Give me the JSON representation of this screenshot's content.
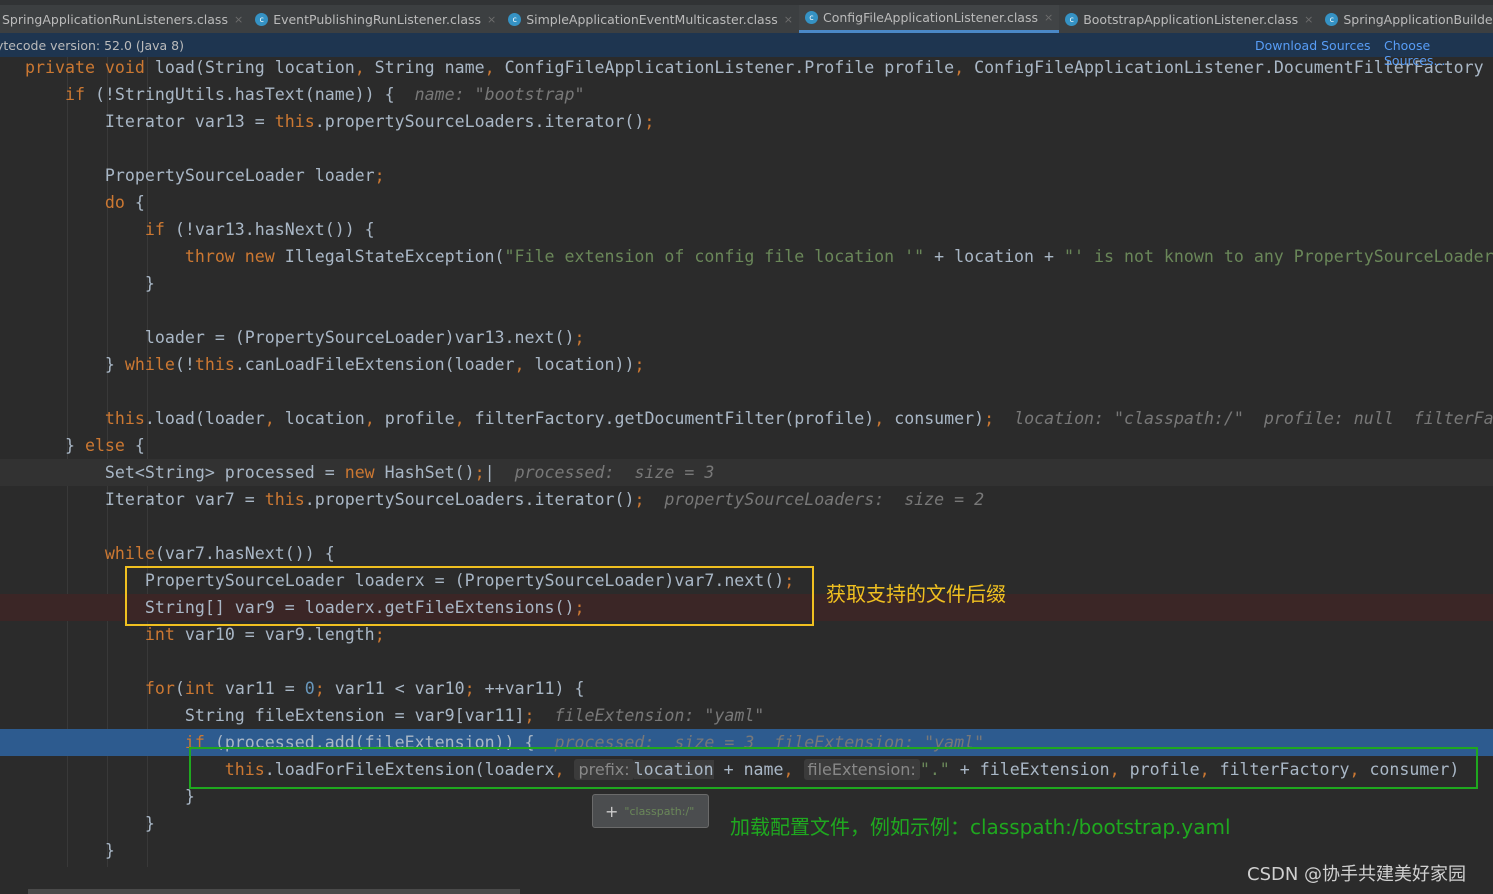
{
  "tabs": [
    {
      "label": "SpringApplicationRunListeners.class",
      "active": false
    },
    {
      "label": "EventPublishingRunListener.class",
      "active": false
    },
    {
      "label": "SimpleApplicationEventMulticaster.class",
      "active": false
    },
    {
      "label": "ConfigFileApplicationListener.class",
      "active": true
    },
    {
      "label": "BootstrapApplicationListener.class",
      "active": false
    },
    {
      "label": "SpringApplicationBuilder.class",
      "active": false
    }
  ],
  "info_bar": {
    "version": "ytecode version: 52.0 (Java 8)",
    "download": "Download Sources",
    "choose": "Choose Sources..."
  },
  "code_lines": [
    {
      "bg": "",
      "tokens": [
        [
          "k",
          "private void "
        ],
        [
          "t",
          "load(String location"
        ],
        [
          "k",
          ", "
        ],
        [
          "t",
          "String name"
        ],
        [
          "k",
          ", "
        ],
        [
          "t",
          "ConfigFileApplicationListener.Profile profile"
        ],
        [
          "k",
          ", "
        ],
        [
          "t",
          "ConfigFileApplicationListener.DocumentFilterFactory"
        ]
      ]
    },
    {
      "bg": "",
      "tokens": [
        [
          "k",
          "    if "
        ],
        [
          "t",
          "(!StringUtils.hasText(name)) {  "
        ],
        [
          "h",
          "name: \"bootstrap\""
        ]
      ]
    },
    {
      "bg": "",
      "tokens": [
        [
          "t",
          "        Iterator var13 = "
        ],
        [
          "k",
          "this"
        ],
        [
          "t",
          ".propertySourceLoaders.iterator()"
        ],
        [
          "k",
          ";"
        ]
      ]
    },
    {
      "bg": "",
      "tokens": []
    },
    {
      "bg": "",
      "tokens": [
        [
          "t",
          "        PropertySourceLoader loader"
        ],
        [
          "k",
          ";"
        ]
      ]
    },
    {
      "bg": "",
      "tokens": [
        [
          "k",
          "        do "
        ],
        [
          "t",
          "{"
        ]
      ]
    },
    {
      "bg": "",
      "tokens": [
        [
          "k",
          "            if "
        ],
        [
          "t",
          "(!var13.hasNext()) {"
        ]
      ]
    },
    {
      "bg": "",
      "tokens": [
        [
          "k",
          "                throw new "
        ],
        [
          "t",
          "IllegalStateException("
        ],
        [
          "s",
          "\"File extension of config file location '\""
        ],
        [
          "t",
          " + location + "
        ],
        [
          "s",
          "\"' is not known to any PropertySourceLoader"
        ]
      ]
    },
    {
      "bg": "",
      "tokens": [
        [
          "t",
          "            }"
        ]
      ]
    },
    {
      "bg": "",
      "tokens": []
    },
    {
      "bg": "",
      "tokens": [
        [
          "t",
          "            loader = (PropertySourceLoader)var13.next()"
        ],
        [
          "k",
          ";"
        ]
      ]
    },
    {
      "bg": "",
      "tokens": [
        [
          "t",
          "        } "
        ],
        [
          "k",
          "while"
        ],
        [
          "t",
          "(!"
        ],
        [
          "k",
          "this"
        ],
        [
          "t",
          ".canLoadFileExtension(loader"
        ],
        [
          "k",
          ", "
        ],
        [
          "t",
          "location))"
        ],
        [
          "k",
          ";"
        ]
      ]
    },
    {
      "bg": "",
      "tokens": []
    },
    {
      "bg": "",
      "tokens": [
        [
          "k",
          "        this"
        ],
        [
          "t",
          ".load(loader"
        ],
        [
          "k",
          ", "
        ],
        [
          "t",
          "location"
        ],
        [
          "k",
          ", "
        ],
        [
          "t",
          "profile"
        ],
        [
          "k",
          ", "
        ],
        [
          "t",
          "filterFactory.getDocumentFilter(profile)"
        ],
        [
          "k",
          ", "
        ],
        [
          "t",
          "consumer)"
        ],
        [
          "k",
          ";  "
        ],
        [
          "h",
          "location: \"classpath:/\"  profile: null  filterFa"
        ]
      ]
    },
    {
      "bg": "",
      "tokens": [
        [
          "t",
          "    } "
        ],
        [
          "k",
          "else "
        ],
        [
          "t",
          "{"
        ]
      ]
    },
    {
      "bg": "cur",
      "tokens": [
        [
          "t",
          "        Set<String> processed = "
        ],
        [
          "k",
          "new "
        ],
        [
          "t",
          "HashSet()"
        ],
        [
          "k",
          ";"
        ],
        [
          "t",
          "|  "
        ],
        [
          "h",
          "processed:  size = 3"
        ]
      ]
    },
    {
      "bg": "",
      "tokens": [
        [
          "t",
          "        Iterator var7 = "
        ],
        [
          "k",
          "this"
        ],
        [
          "t",
          ".propertySourceLoaders.iterator()"
        ],
        [
          "k",
          ";  "
        ],
        [
          "h",
          "propertySourceLoaders:  size = 2"
        ]
      ]
    },
    {
      "bg": "",
      "tokens": []
    },
    {
      "bg": "",
      "tokens": [
        [
          "k",
          "        while"
        ],
        [
          "t",
          "(var7.hasNext()) {"
        ]
      ]
    },
    {
      "bg": "",
      "tokens": [
        [
          "t",
          "            PropertySourceLoader loaderx = (PropertySourceLoader)var7.next()"
        ],
        [
          "k",
          ";"
        ]
      ]
    },
    {
      "bg": "bp",
      "tokens": [
        [
          "t",
          "            String[] var9 = loaderx.getFileExtensions()"
        ],
        [
          "k",
          ";"
        ]
      ]
    },
    {
      "bg": "",
      "tokens": [
        [
          "k",
          "            int "
        ],
        [
          "t",
          "var10 = var9.length"
        ],
        [
          "k",
          ";"
        ]
      ]
    },
    {
      "bg": "",
      "tokens": []
    },
    {
      "bg": "",
      "tokens": [
        [
          "k",
          "            for"
        ],
        [
          "t",
          "("
        ],
        [
          "k",
          "int "
        ],
        [
          "t",
          "var11 = "
        ],
        [
          "n",
          "0"
        ],
        [
          "k",
          "; "
        ],
        [
          "t",
          "var11 < var10"
        ],
        [
          "k",
          "; "
        ],
        [
          "t",
          "++var11) {"
        ]
      ]
    },
    {
      "bg": "",
      "tokens": [
        [
          "t",
          "                String fileExtension = var9[var11]"
        ],
        [
          "k",
          ";  "
        ],
        [
          "h",
          "fileExtension: \"yaml\""
        ]
      ]
    },
    {
      "bg": "exec",
      "tokens": [
        [
          "k",
          "                if "
        ],
        [
          "t",
          "(processed.add(fileExtension)) {  "
        ],
        [
          "h",
          "processed:  size = 3  fileExtension: \"yaml\""
        ]
      ]
    },
    {
      "bg": "",
      "tokens": [
        [
          "k",
          "                    this"
        ],
        [
          "t",
          ".loadForFileExtension(loaderx"
        ],
        [
          "k",
          ", "
        ],
        [
          "p",
          "prefix:"
        ],
        [
          "loc",
          "location"
        ],
        [
          "t",
          " + name"
        ],
        [
          "k",
          ", "
        ],
        [
          "p",
          "fileExtension:"
        ],
        [
          "s",
          "\".\""
        ],
        [
          "t",
          " + fileExtension"
        ],
        [
          "k",
          ", "
        ],
        [
          "t",
          "profile"
        ],
        [
          "k",
          ", "
        ],
        [
          "t",
          "filterFactory"
        ],
        [
          "k",
          ", "
        ],
        [
          "t",
          "consumer)"
        ]
      ]
    },
    {
      "bg": "",
      "tokens": [
        [
          "t",
          "                }"
        ]
      ]
    },
    {
      "bg": "",
      "tokens": [
        [
          "t",
          "            }"
        ]
      ]
    },
    {
      "bg": "",
      "tokens": [
        [
          "t",
          "        }"
        ]
      ]
    }
  ],
  "annotations": {
    "yellow_note": "获取支持的文件后缀",
    "green_note": "加载配置文件，例如示例：classpath:/bootstrap.yaml"
  },
  "tooltip": {
    "value": "\"classpath:/\""
  },
  "watermark": "CSDN @协手共建美好家园",
  "colors": {
    "keyword": "#cc7832",
    "string": "#6a8759",
    "number": "#6897bb",
    "yellow_box": "#f0c020",
    "green_box": "#1fa81f"
  }
}
